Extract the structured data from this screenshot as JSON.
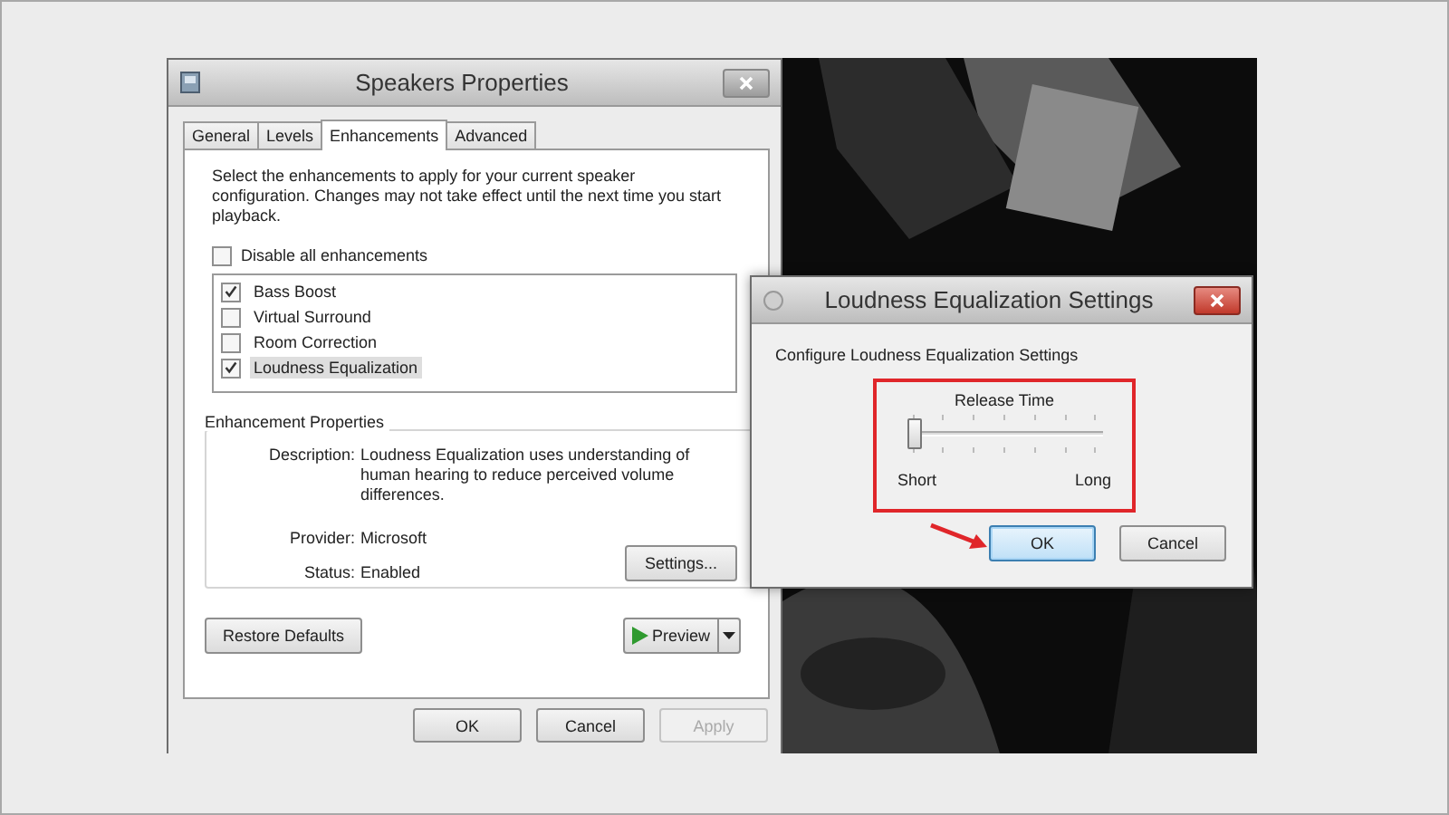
{
  "speakers_window": {
    "title": "Speakers Properties",
    "tabs": [
      {
        "label": "General",
        "selected": false
      },
      {
        "label": "Levels",
        "selected": false
      },
      {
        "label": "Enhancements",
        "selected": true
      },
      {
        "label": "Advanced",
        "selected": false
      }
    ],
    "intro": "Select the enhancements to apply for your current speaker configuration. Changes may not take effect until the next time you start playback.",
    "disable_all": {
      "label": "Disable all enhancements",
      "checked": false
    },
    "enhancements": [
      {
        "label": "Bass Boost",
        "checked": true,
        "selected": false
      },
      {
        "label": "Virtual Surround",
        "checked": false,
        "selected": false
      },
      {
        "label": "Room Correction",
        "checked": false,
        "selected": false
      },
      {
        "label": "Loudness Equalization",
        "checked": true,
        "selected": true
      }
    ],
    "properties": {
      "heading": "Enhancement Properties",
      "description_label": "Description:",
      "description": "Loudness Equalization uses understanding of human hearing to reduce perceived volume differences.",
      "provider_label": "Provider:",
      "provider": "Microsoft",
      "status_label": "Status:",
      "status": "Enabled",
      "settings_button": "Settings..."
    },
    "restore_button": "Restore Defaults",
    "preview_button": "Preview",
    "buttons": [
      {
        "label": "OK",
        "disabled": false
      },
      {
        "label": "Cancel",
        "disabled": false
      },
      {
        "label": "Apply",
        "disabled": true
      }
    ]
  },
  "loudness_window": {
    "title": "Loudness Equalization Settings",
    "heading": "Configure Loudness Equalization Settings",
    "slider": {
      "label": "Release Time",
      "level": 0,
      "min_label": "Short",
      "max_label": "Long"
    },
    "buttons": [
      {
        "label": "OK",
        "default": true
      },
      {
        "label": "Cancel",
        "default": false
      }
    ]
  }
}
